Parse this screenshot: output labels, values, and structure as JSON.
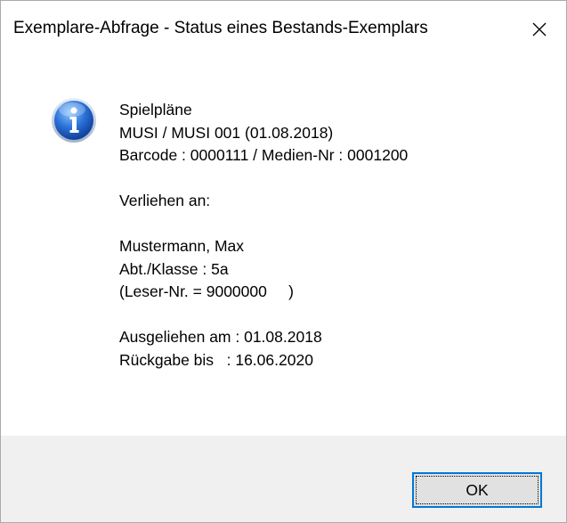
{
  "window": {
    "title": "Exemplare-Abfrage - Status eines Bestands-Exemplars",
    "close_symbol": "✕"
  },
  "icon": {
    "name": "info-icon",
    "glyph": "i"
  },
  "message": {
    "lines": [
      "Spielpläne",
      "MUSI / MUSI 001 (01.08.2018)",
      "Barcode : 0000111 / Medien-Nr : 0001200",
      "",
      "Verliehen an:",
      "",
      "Mustermann, Max",
      "Abt./Klasse : 5a",
      "(Leser-Nr. = 9000000     )",
      "",
      "Ausgeliehen am : 01.08.2018",
      "Rückgabe bis   : 16.06.2020"
    ]
  },
  "buttons": {
    "ok_label": "OK"
  },
  "colors": {
    "accent": "#0078d7",
    "footer_bg": "#f0f0f0",
    "button_bg": "#e1e1e1"
  }
}
